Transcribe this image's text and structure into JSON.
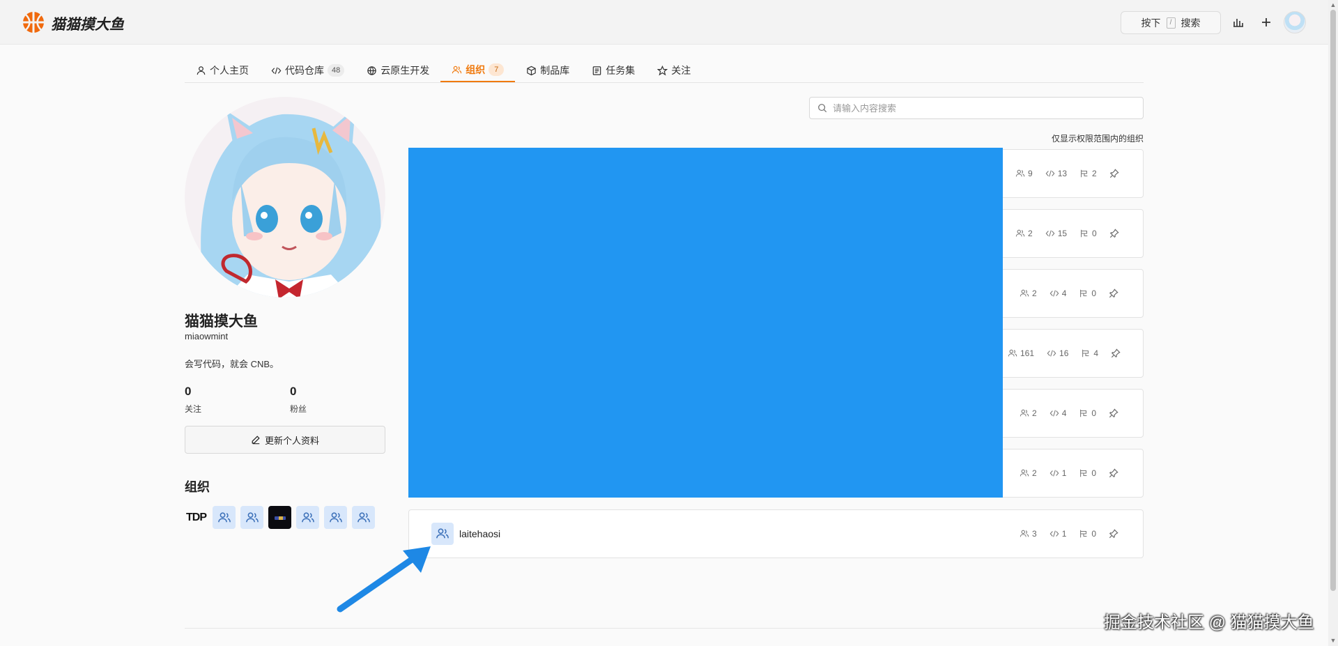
{
  "header": {
    "brand": "猫猫摸大鱼",
    "search_press": "按下",
    "search_key": "/",
    "search_label": "搜索"
  },
  "tabs": [
    {
      "label": "个人主页",
      "icon": "user-icon"
    },
    {
      "label": "代码仓库",
      "icon": "code-icon",
      "count": "48"
    },
    {
      "label": "云原生开发",
      "icon": "cloud-native-icon"
    },
    {
      "label": "组织",
      "icon": "group-icon",
      "count": "7",
      "active": true
    },
    {
      "label": "制品库",
      "icon": "package-icon"
    },
    {
      "label": "任务集",
      "icon": "list-icon"
    },
    {
      "label": "关注",
      "icon": "star-icon"
    }
  ],
  "profile": {
    "name": "猫猫摸大鱼",
    "username": "miaowmint",
    "bio": "会写代码，就会 CNB。",
    "following_count": "0",
    "following_label": "关注",
    "followers_count": "0",
    "followers_label": "粉丝",
    "edit_label": "更新个人资料",
    "orgs_title": "组织",
    "org_tdp": "TDP"
  },
  "search": {
    "placeholder": "请输入内容搜索"
  },
  "scope_note": "仅显示权限范围内的组织",
  "orgs": [
    {
      "members": "9",
      "repos": "13",
      "missions": "2"
    },
    {
      "members": "2",
      "repos": "15",
      "missions": "0"
    },
    {
      "members": "2",
      "repos": "4",
      "missions": "0"
    },
    {
      "members": "161",
      "repos": "16",
      "missions": "4"
    },
    {
      "members": "2",
      "repos": "4",
      "missions": "0"
    },
    {
      "members": "2",
      "repos": "1",
      "missions": "0"
    },
    {
      "name": "laitehaosi",
      "members": "3",
      "repos": "1",
      "missions": "0"
    }
  ],
  "colors": {
    "accent": "#f07a0e",
    "redaction": "#2196f2",
    "arrow": "#1e88e5"
  },
  "watermark": "掘金技术社区 @ 猫猫摸大鱼"
}
